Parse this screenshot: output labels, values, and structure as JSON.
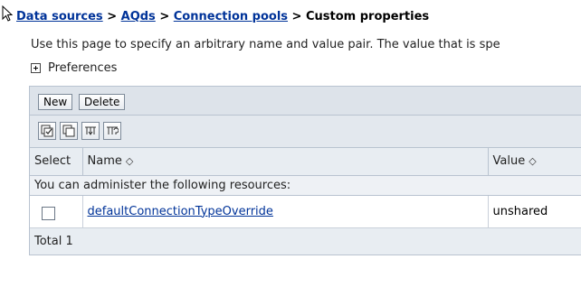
{
  "breadcrumb": {
    "items": [
      "Data sources",
      "AQds",
      "Connection pools"
    ],
    "separator": ">",
    "current": "Custom properties"
  },
  "description": "Use this page to specify an arbitrary name and value pair. The value that is spe",
  "preferences_label": "Preferences",
  "toolbar": {
    "new_label": "New",
    "delete_label": "Delete"
  },
  "icon_toolbar": [
    "select-all-icon",
    "deselect-all-icon",
    "show-filter-icon",
    "clear-filter-icon"
  ],
  "table": {
    "columns": [
      "Select",
      "Name",
      "Value"
    ],
    "sort_glyph": "◇",
    "message": "You can administer the following resources:",
    "rows": [
      {
        "name": "defaultConnectionTypeOverride",
        "value": "unshared"
      }
    ],
    "total": "Total 1"
  },
  "colors": {
    "link": "#003399",
    "header_bg": "#dde3ea",
    "border": "#b9c3d0"
  }
}
